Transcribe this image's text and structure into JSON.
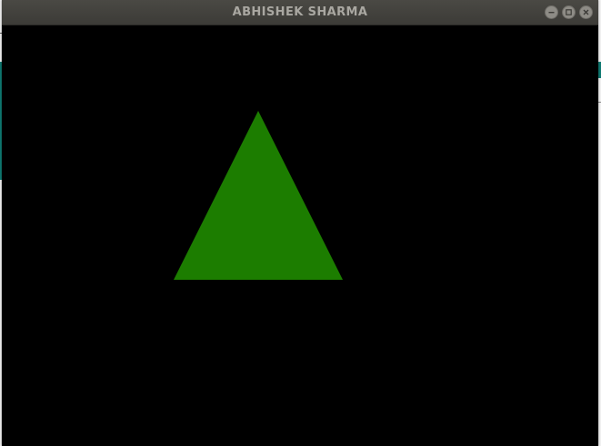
{
  "window": {
    "title": "ABHISHEK SHARMA",
    "controls": {
      "minimize_icon": "minimize-icon",
      "maximize_icon": "maximize-icon",
      "close_icon": "close-icon"
    }
  },
  "canvas": {
    "background_color": "#000000",
    "shape": {
      "type": "triangle",
      "fill_color": "#1c7d00"
    }
  }
}
